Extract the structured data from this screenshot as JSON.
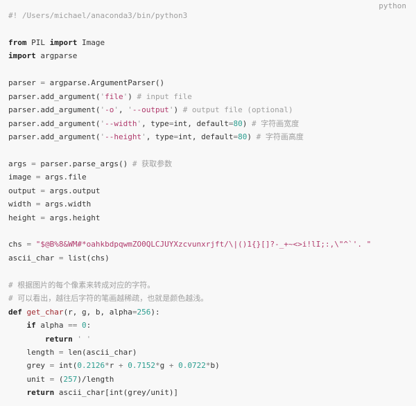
{
  "code_block": {
    "language": "python",
    "lines": [
      [
        {
          "t": "cm",
          "v": "#! /Users/michael/anaconda3/bin/python3"
        }
      ],
      [],
      [
        {
          "t": "kw",
          "v": "from"
        },
        {
          "t": "tx",
          "v": " PIL "
        },
        {
          "t": "kw",
          "v": "import"
        },
        {
          "t": "tx",
          "v": " Image"
        }
      ],
      [
        {
          "t": "kw",
          "v": "import"
        },
        {
          "t": "tx",
          "v": " argparse"
        }
      ],
      [],
      [
        {
          "t": "tx",
          "v": "parser "
        },
        {
          "t": "op",
          "v": "="
        },
        {
          "t": "tx",
          "v": " argparse.ArgumentParser()"
        }
      ],
      [
        {
          "t": "tx",
          "v": "parser.add_argument("
        },
        {
          "t": "q",
          "v": "'"
        },
        {
          "t": "st",
          "v": "file"
        },
        {
          "t": "q",
          "v": "'"
        },
        {
          "t": "tx",
          "v": ") "
        },
        {
          "t": "cm",
          "v": "# input file"
        }
      ],
      [
        {
          "t": "tx",
          "v": "parser.add_argument("
        },
        {
          "t": "q",
          "v": "'"
        },
        {
          "t": "st",
          "v": "-o"
        },
        {
          "t": "q",
          "v": "'"
        },
        {
          "t": "tx",
          "v": ", "
        },
        {
          "t": "q",
          "v": "'"
        },
        {
          "t": "st",
          "v": "--output"
        },
        {
          "t": "q",
          "v": "'"
        },
        {
          "t": "tx",
          "v": ") "
        },
        {
          "t": "cm",
          "v": "# output file (optional)"
        }
      ],
      [
        {
          "t": "tx",
          "v": "parser.add_argument("
        },
        {
          "t": "q",
          "v": "'"
        },
        {
          "t": "st",
          "v": "--width"
        },
        {
          "t": "q",
          "v": "'"
        },
        {
          "t": "tx",
          "v": ", type"
        },
        {
          "t": "op",
          "v": "="
        },
        {
          "t": "tx",
          "v": "int, default"
        },
        {
          "t": "op",
          "v": "="
        },
        {
          "t": "nu",
          "v": "80"
        },
        {
          "t": "tx",
          "v": ") "
        },
        {
          "t": "cm",
          "v": "# 字符画宽度"
        }
      ],
      [
        {
          "t": "tx",
          "v": "parser.add_argument("
        },
        {
          "t": "q",
          "v": "'"
        },
        {
          "t": "st",
          "v": "--height"
        },
        {
          "t": "q",
          "v": "'"
        },
        {
          "t": "tx",
          "v": ", type"
        },
        {
          "t": "op",
          "v": "="
        },
        {
          "t": "tx",
          "v": "int, default"
        },
        {
          "t": "op",
          "v": "="
        },
        {
          "t": "nu",
          "v": "80"
        },
        {
          "t": "tx",
          "v": ") "
        },
        {
          "t": "cm",
          "v": "# 字符画高度"
        }
      ],
      [],
      [
        {
          "t": "tx",
          "v": "args "
        },
        {
          "t": "op",
          "v": "="
        },
        {
          "t": "tx",
          "v": " parser.parse_args() "
        },
        {
          "t": "cm",
          "v": "# 获取参数"
        }
      ],
      [
        {
          "t": "tx",
          "v": "image "
        },
        {
          "t": "op",
          "v": "="
        },
        {
          "t": "tx",
          "v": " args.file"
        }
      ],
      [
        {
          "t": "tx",
          "v": "output "
        },
        {
          "t": "op",
          "v": "="
        },
        {
          "t": "tx",
          "v": " args.output"
        }
      ],
      [
        {
          "t": "tx",
          "v": "width "
        },
        {
          "t": "op",
          "v": "="
        },
        {
          "t": "tx",
          "v": " args.width"
        }
      ],
      [
        {
          "t": "tx",
          "v": "height "
        },
        {
          "t": "op",
          "v": "="
        },
        {
          "t": "tx",
          "v": " args.height"
        }
      ],
      [],
      [
        {
          "t": "tx",
          "v": "chs "
        },
        {
          "t": "op",
          "v": "="
        },
        {
          "t": "tx",
          "v": " "
        },
        {
          "t": "st",
          "v": "\"$@B%8&WM#*oahkbdpqwmZO0QLCJUYXzcvunxrjft/\\|()1{}[]?-_+~<>i!lI;:,\\\"^`'. \""
        }
      ],
      [
        {
          "t": "tx",
          "v": "ascii_char "
        },
        {
          "t": "op",
          "v": "="
        },
        {
          "t": "tx",
          "v": " list(chs)"
        }
      ],
      [],
      [
        {
          "t": "cm",
          "v": "# 根据图片的每个像素来转成对应的字符。"
        }
      ],
      [
        {
          "t": "cm",
          "v": "# 可以看出，越往后字符的笔画越稀疏，也就是颜色越浅。"
        }
      ],
      [
        {
          "t": "kw",
          "v": "def"
        },
        {
          "t": "tx",
          "v": " "
        },
        {
          "t": "fn",
          "v": "get_char"
        },
        {
          "t": "tx",
          "v": "(r, g, b, alpha"
        },
        {
          "t": "op",
          "v": "="
        },
        {
          "t": "nu",
          "v": "256"
        },
        {
          "t": "tx",
          "v": "):"
        }
      ],
      [
        {
          "t": "tx",
          "v": "    "
        },
        {
          "t": "kw",
          "v": "if"
        },
        {
          "t": "tx",
          "v": " alpha "
        },
        {
          "t": "op",
          "v": "=="
        },
        {
          "t": "tx",
          "v": " "
        },
        {
          "t": "nu",
          "v": "0"
        },
        {
          "t": "tx",
          "v": ":"
        }
      ],
      [
        {
          "t": "tx",
          "v": "        "
        },
        {
          "t": "kw",
          "v": "return"
        },
        {
          "t": "tx",
          "v": " "
        },
        {
          "t": "q",
          "v": "' '"
        }
      ],
      [
        {
          "t": "tx",
          "v": "    length "
        },
        {
          "t": "op",
          "v": "="
        },
        {
          "t": "tx",
          "v": " len(ascii_char)"
        }
      ],
      [
        {
          "t": "tx",
          "v": "    grey "
        },
        {
          "t": "op",
          "v": "="
        },
        {
          "t": "tx",
          "v": " int("
        },
        {
          "t": "nu",
          "v": "0.2126"
        },
        {
          "t": "op",
          "v": "*"
        },
        {
          "t": "tx",
          "v": "r "
        },
        {
          "t": "op",
          "v": "+"
        },
        {
          "t": "tx",
          "v": " "
        },
        {
          "t": "nu",
          "v": "0.7152"
        },
        {
          "t": "op",
          "v": "*"
        },
        {
          "t": "tx",
          "v": "g "
        },
        {
          "t": "op",
          "v": "+"
        },
        {
          "t": "tx",
          "v": " "
        },
        {
          "t": "nu",
          "v": "0.0722"
        },
        {
          "t": "op",
          "v": "*"
        },
        {
          "t": "tx",
          "v": "b)"
        }
      ],
      [
        {
          "t": "tx",
          "v": "    unit "
        },
        {
          "t": "op",
          "v": "="
        },
        {
          "t": "tx",
          "v": " ("
        },
        {
          "t": "nu",
          "v": "257"
        },
        {
          "t": "tx",
          "v": ")/length"
        }
      ],
      [
        {
          "t": "tx",
          "v": "    "
        },
        {
          "t": "kw",
          "v": "return"
        },
        {
          "t": "tx",
          "v": " ascii_char[int(grey/unit)]"
        }
      ]
    ]
  }
}
